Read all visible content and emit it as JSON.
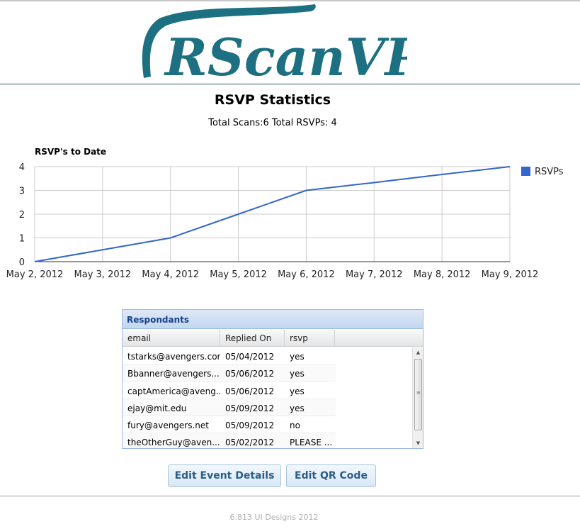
{
  "logo": {
    "text": "RScanVP",
    "color": "#1d6f82"
  },
  "page": {
    "title": "RSVP Statistics",
    "totals": "Total Scans:6 Total RSVPs: 4"
  },
  "chart_data": {
    "type": "line",
    "title": "RSVP's to Date",
    "xlabel": "",
    "ylabel": "",
    "categories": [
      "May 2, 2012",
      "May 3, 2012",
      "May 4, 2012",
      "May 5, 2012",
      "May 6, 2012",
      "May 7, 2012",
      "May 8, 2012",
      "May 9, 2012"
    ],
    "series": [
      {
        "name": "RSVPs",
        "values": [
          0,
          0.5,
          1,
          2,
          3,
          3.33,
          3.67,
          4
        ],
        "color": "#3366cc"
      }
    ],
    "ylim": [
      0,
      4
    ],
    "yticks": [
      0,
      1,
      2,
      3,
      4
    ],
    "grid": true,
    "legend": "right"
  },
  "respondants": {
    "title": "Respondants",
    "columns": [
      "email",
      "Replied On",
      "rsvp"
    ],
    "rows": [
      {
        "email": "tstarks@avengers.com",
        "replied_on": "05/04/2012",
        "rsvp": "yes"
      },
      {
        "email": "Bbanner@avengers....",
        "replied_on": "05/06/2012",
        "rsvp": "yes"
      },
      {
        "email": "captAmerica@aveng...",
        "replied_on": "05/06/2012",
        "rsvp": "yes"
      },
      {
        "email": "ejay@mit.edu",
        "replied_on": "05/09/2012",
        "rsvp": "yes"
      },
      {
        "email": "fury@avengers.net",
        "replied_on": "05/09/2012",
        "rsvp": "no"
      },
      {
        "email": "theOtherGuy@aven...",
        "replied_on": "05/02/2012",
        "rsvp": "PLEASE ..."
      }
    ]
  },
  "actions": {
    "edit_event": "Edit Event Details",
    "edit_qr": "Edit QR Code"
  },
  "footer": {
    "text": "6.813 UI Designs 2012"
  },
  "icons": {
    "scroll_up": "scroll-up-arrow-icon",
    "scroll_down": "scroll-down-arrow-icon"
  }
}
